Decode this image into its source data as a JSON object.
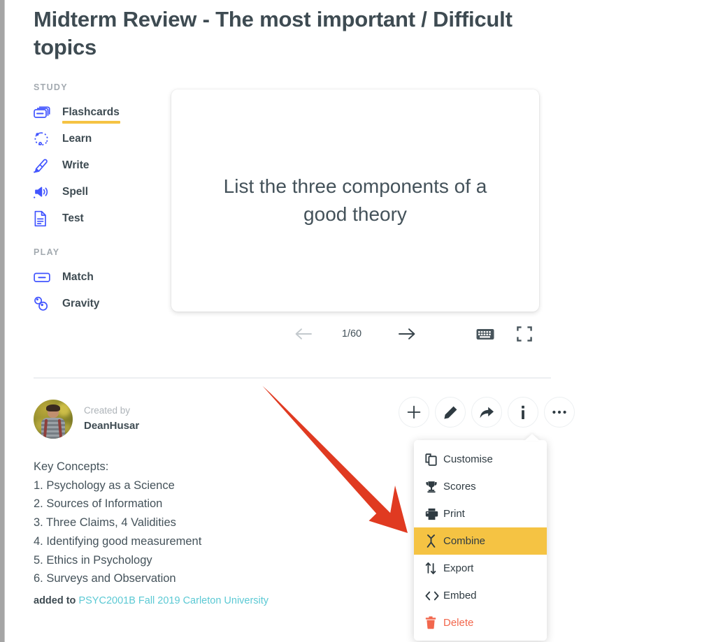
{
  "page_title": "Midterm Review - The most important / Difficult topics",
  "colors": {
    "accent_yellow": "#f5c343",
    "icon_blue": "#4255ff",
    "text_dark": "#3e4b52",
    "link_teal": "#5bc9d4",
    "danger_red": "#f2674d",
    "annotation_red": "#e03a21"
  },
  "sidebar": {
    "study_heading": "STUDY",
    "play_heading": "PLAY",
    "study_items": [
      {
        "label": "Flashcards",
        "icon": "flashcards-icon",
        "active": true
      },
      {
        "label": "Learn",
        "icon": "learn-icon",
        "active": false
      },
      {
        "label": "Write",
        "icon": "write-icon",
        "active": false
      },
      {
        "label": "Spell",
        "icon": "spell-icon",
        "active": false
      },
      {
        "label": "Test",
        "icon": "test-icon",
        "active": false
      }
    ],
    "play_items": [
      {
        "label": "Match",
        "icon": "match-icon",
        "active": false
      },
      {
        "label": "Gravity",
        "icon": "gravity-icon",
        "active": false
      }
    ]
  },
  "flashcard": {
    "text": "List the three components of a good theory",
    "counter": "1/60",
    "prev_icon": "arrow-left-icon",
    "next_icon": "arrow-right-icon",
    "keyboard_icon": "keyboard-icon",
    "fullscreen_icon": "fullscreen-icon"
  },
  "author": {
    "created_by_label": "Created by",
    "name": "DeanHusar",
    "avatar_icon": "avatar"
  },
  "actions": [
    {
      "name": "add-button",
      "icon": "plus-icon"
    },
    {
      "name": "edit-button",
      "icon": "pencil-icon"
    },
    {
      "name": "share-button",
      "icon": "share-arrow-icon"
    },
    {
      "name": "info-button",
      "icon": "info-icon"
    },
    {
      "name": "more-options-button",
      "icon": "ellipsis-icon"
    }
  ],
  "menu": {
    "items": [
      {
        "label": "Customise",
        "icon": "copy-icon",
        "highlight": false,
        "danger": false
      },
      {
        "label": "Scores",
        "icon": "trophy-icon",
        "highlight": false,
        "danger": false
      },
      {
        "label": "Print",
        "icon": "printer-icon",
        "highlight": false,
        "danger": false
      },
      {
        "label": "Combine",
        "icon": "merge-icon",
        "highlight": true,
        "danger": false
      },
      {
        "label": "Export",
        "icon": "export-arrows-icon",
        "highlight": false,
        "danger": false
      },
      {
        "label": "Embed",
        "icon": "code-brackets-icon",
        "highlight": false,
        "danger": false
      },
      {
        "label": "Delete",
        "icon": "trash-icon",
        "highlight": false,
        "danger": true
      }
    ]
  },
  "description": {
    "heading": "Key Concepts:",
    "lines": [
      "1. Psychology as a Science",
      "2. Sources of Information",
      "3. Three Claims, 4 Validities",
      "4. Identifying good measurement",
      "5. Ethics in Psychology",
      "6. Surveys and Observation"
    ]
  },
  "added_to": {
    "label": "added to",
    "link": "PSYC2001B Fall 2019 Carleton University"
  },
  "annotation": {
    "type": "red-arrow",
    "points_at": "Combine"
  }
}
